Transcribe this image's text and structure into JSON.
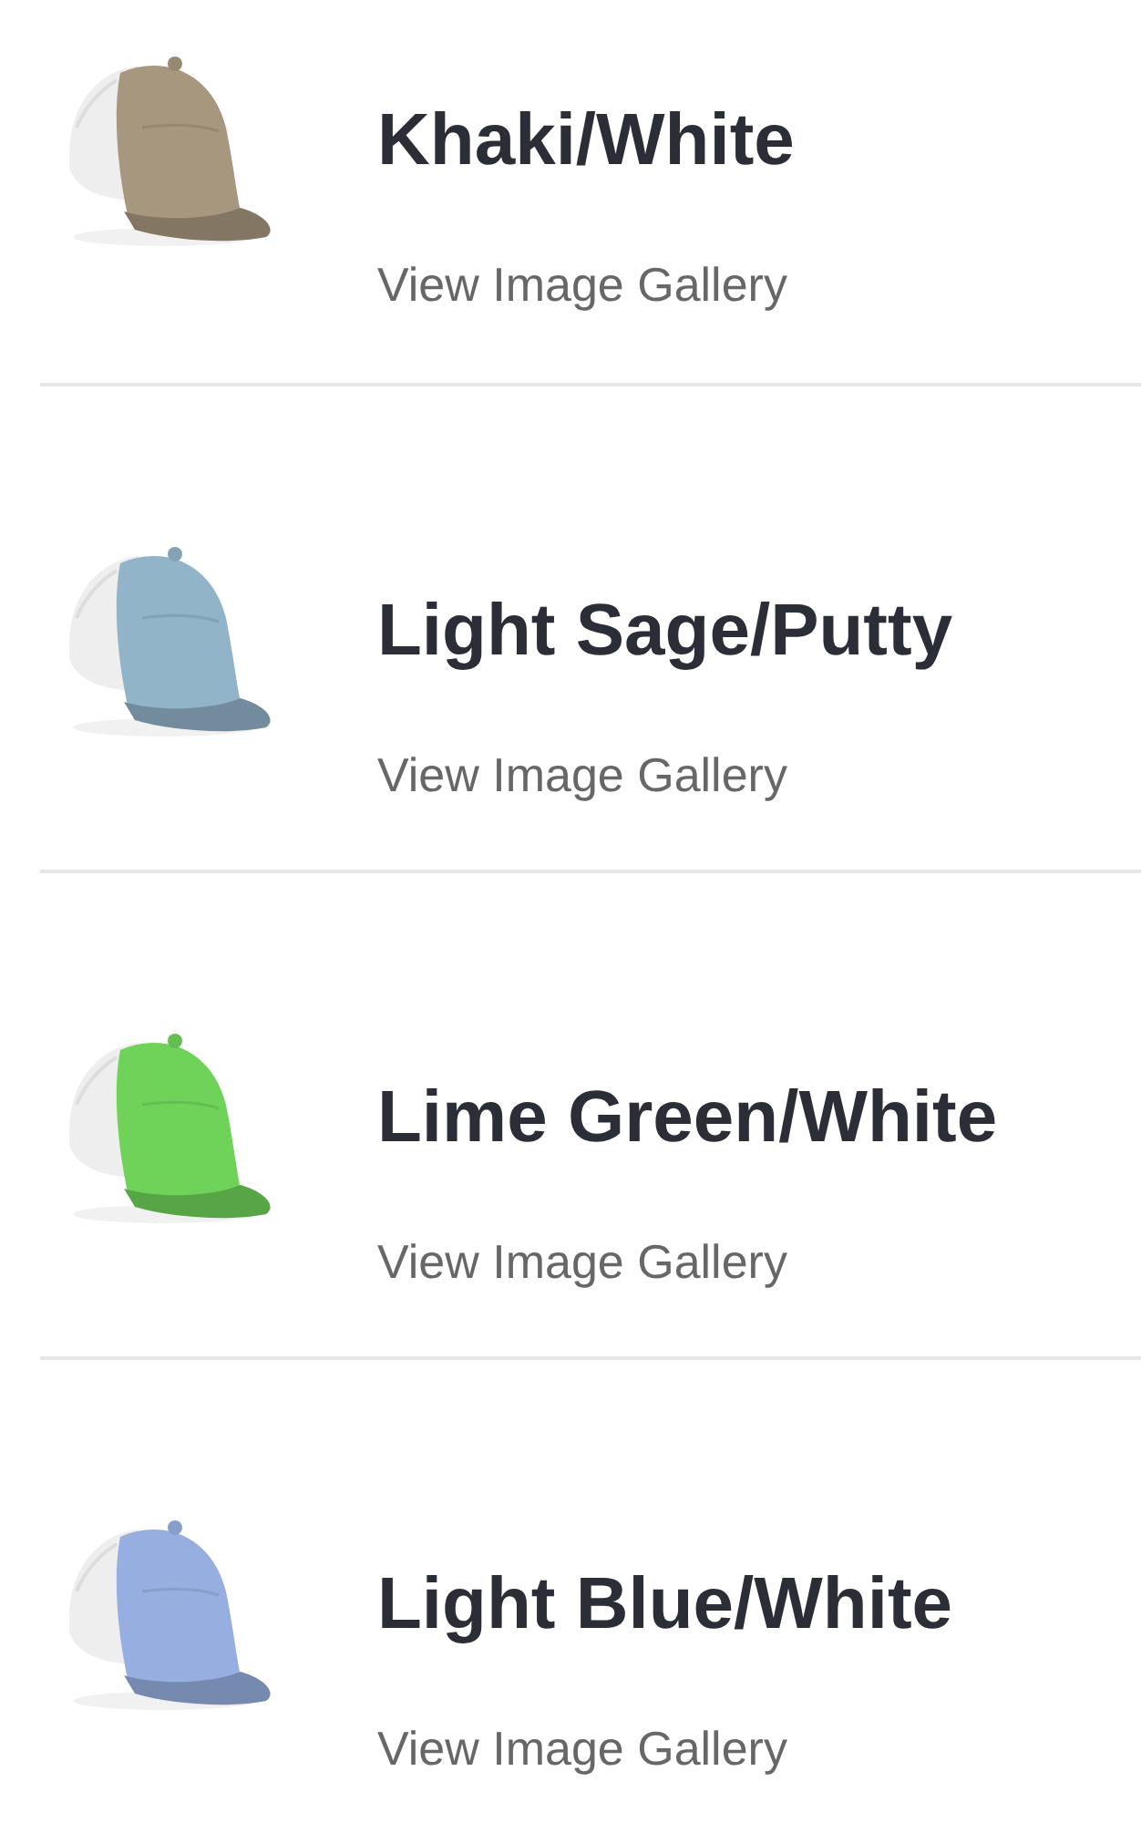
{
  "products": [
    {
      "name": "Khaki/White",
      "link": "View Image Gallery",
      "color": "#a8977f"
    },
    {
      "name": "Light Sage/Putty",
      "link": "View Image Gallery",
      "color": "#92b4c9"
    },
    {
      "name": "Lime Green/White",
      "link": "View Image Gallery",
      "color": "#6fd35a"
    },
    {
      "name": "Light Blue/White",
      "link": "View Image Gallery",
      "color": "#97afe0"
    }
  ]
}
